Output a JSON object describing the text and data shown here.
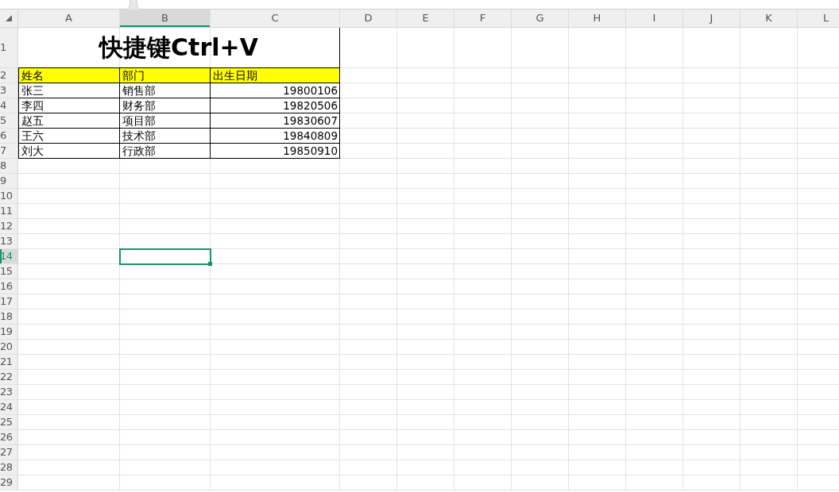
{
  "columns": [
    {
      "label": "A",
      "selected": false
    },
    {
      "label": "B",
      "selected": true
    },
    {
      "label": "C",
      "selected": false
    },
    {
      "label": "D",
      "selected": false
    },
    {
      "label": "E",
      "selected": false
    },
    {
      "label": "F",
      "selected": false
    },
    {
      "label": "G",
      "selected": false
    },
    {
      "label": "H",
      "selected": false
    },
    {
      "label": "I",
      "selected": false
    },
    {
      "label": "J",
      "selected": false
    },
    {
      "label": "K",
      "selected": false
    },
    {
      "label": "L",
      "selected": false
    }
  ],
  "rows": [
    {
      "label": "1",
      "selected": false
    },
    {
      "label": "2",
      "selected": false
    },
    {
      "label": "3",
      "selected": false
    },
    {
      "label": "4",
      "selected": false
    },
    {
      "label": "5",
      "selected": false
    },
    {
      "label": "6",
      "selected": false
    },
    {
      "label": "7",
      "selected": false
    },
    {
      "label": "8",
      "selected": false
    },
    {
      "label": "9",
      "selected": false
    },
    {
      "label": "10",
      "selected": false
    },
    {
      "label": "11",
      "selected": false
    },
    {
      "label": "12",
      "selected": false
    },
    {
      "label": "13",
      "selected": false
    },
    {
      "label": "14",
      "selected": true
    },
    {
      "label": "15",
      "selected": false
    },
    {
      "label": "16",
      "selected": false
    },
    {
      "label": "17",
      "selected": false
    },
    {
      "label": "18",
      "selected": false
    },
    {
      "label": "19",
      "selected": false
    },
    {
      "label": "20",
      "selected": false
    },
    {
      "label": "21",
      "selected": false
    },
    {
      "label": "22",
      "selected": false
    },
    {
      "label": "23",
      "selected": false
    },
    {
      "label": "24",
      "selected": false
    },
    {
      "label": "25",
      "selected": false
    },
    {
      "label": "26",
      "selected": false
    },
    {
      "label": "27",
      "selected": false
    },
    {
      "label": "28",
      "selected": false
    },
    {
      "label": "29",
      "selected": false
    }
  ],
  "table": {
    "title": "快捷键Ctrl+V",
    "header": [
      "姓名",
      "部门",
      "出生日期"
    ],
    "records": [
      [
        "张三",
        "销售部",
        "19800106"
      ],
      [
        "李四",
        "财务部",
        "19820506"
      ],
      [
        "赵五",
        "项目部",
        "19830607"
      ],
      [
        "王六",
        "技术部",
        "19840809"
      ],
      [
        "刘大",
        "行政部",
        "19850910"
      ]
    ]
  }
}
